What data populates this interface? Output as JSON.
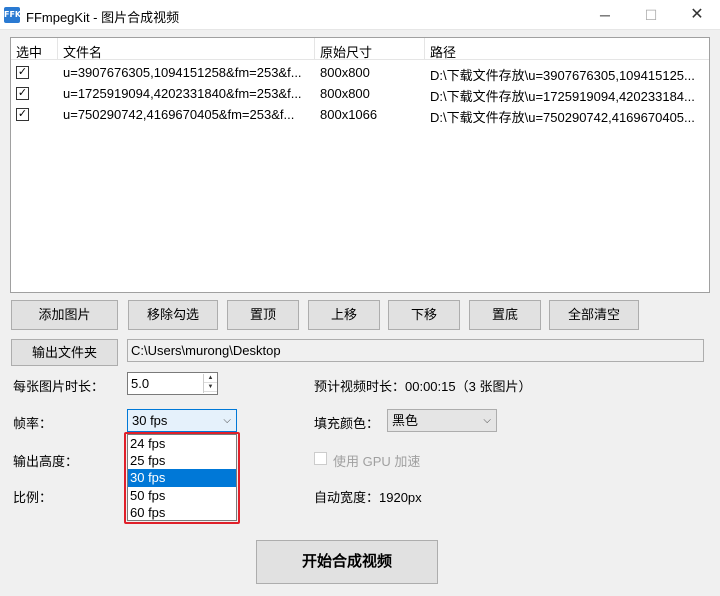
{
  "window": {
    "icon_text": "FFK",
    "title": "FFmpegKit - 图片合成视频",
    "minimize": "─",
    "maximize": "☐",
    "close": "✕"
  },
  "file_list": {
    "headers": {
      "select": "选中",
      "name": "文件名",
      "size": "原始尺寸",
      "path": "路径"
    },
    "rows": [
      {
        "checked": "✓",
        "name": "u=3907676305,1094151258&fm=253&f...",
        "size": "800x800",
        "path": "D:\\下载文件存放\\u=3907676305,109415125..."
      },
      {
        "checked": "✓",
        "name": "u=1725919094,4202331840&fm=253&f...",
        "size": "800x800",
        "path": "D:\\下载文件存放\\u=1725919094,420233184..."
      },
      {
        "checked": "✓",
        "name": "u=750290742,4169670405&fm=253&f...",
        "size": "800x1066",
        "path": "D:\\下载文件存放\\u=750290742,4169670405..."
      }
    ]
  },
  "toolbar": {
    "add": "添加图片",
    "remove_checked": "移除勾选",
    "top": "置顶",
    "up": "上移",
    "down": "下移",
    "bottom": "置底",
    "clear_all": "全部清空"
  },
  "output": {
    "button": "输出文件夹",
    "path": "C:\\Users\\murong\\Desktop"
  },
  "settings": {
    "duration_label": "每张图片时长：",
    "duration_value": "5.0",
    "spin_up": "▲",
    "spin_down": "▼",
    "estimated": "预计视频时长：00:00:15（3 张图片）",
    "fps_label": "帧率：",
    "fps_value": "30 fps",
    "fps_options": [
      "24 fps",
      "25 fps",
      "30 fps",
      "50 fps",
      "60 fps"
    ],
    "fill_label": "填充颜色：",
    "fill_value": "黑色",
    "dropdown_arrow": "⌵",
    "height_label": "输出高度：",
    "gpu_label": "使用 GPU 加速",
    "ratio_label": "比例：",
    "auto_width": "自动宽度：1920px"
  },
  "start_button": "开始合成视频"
}
